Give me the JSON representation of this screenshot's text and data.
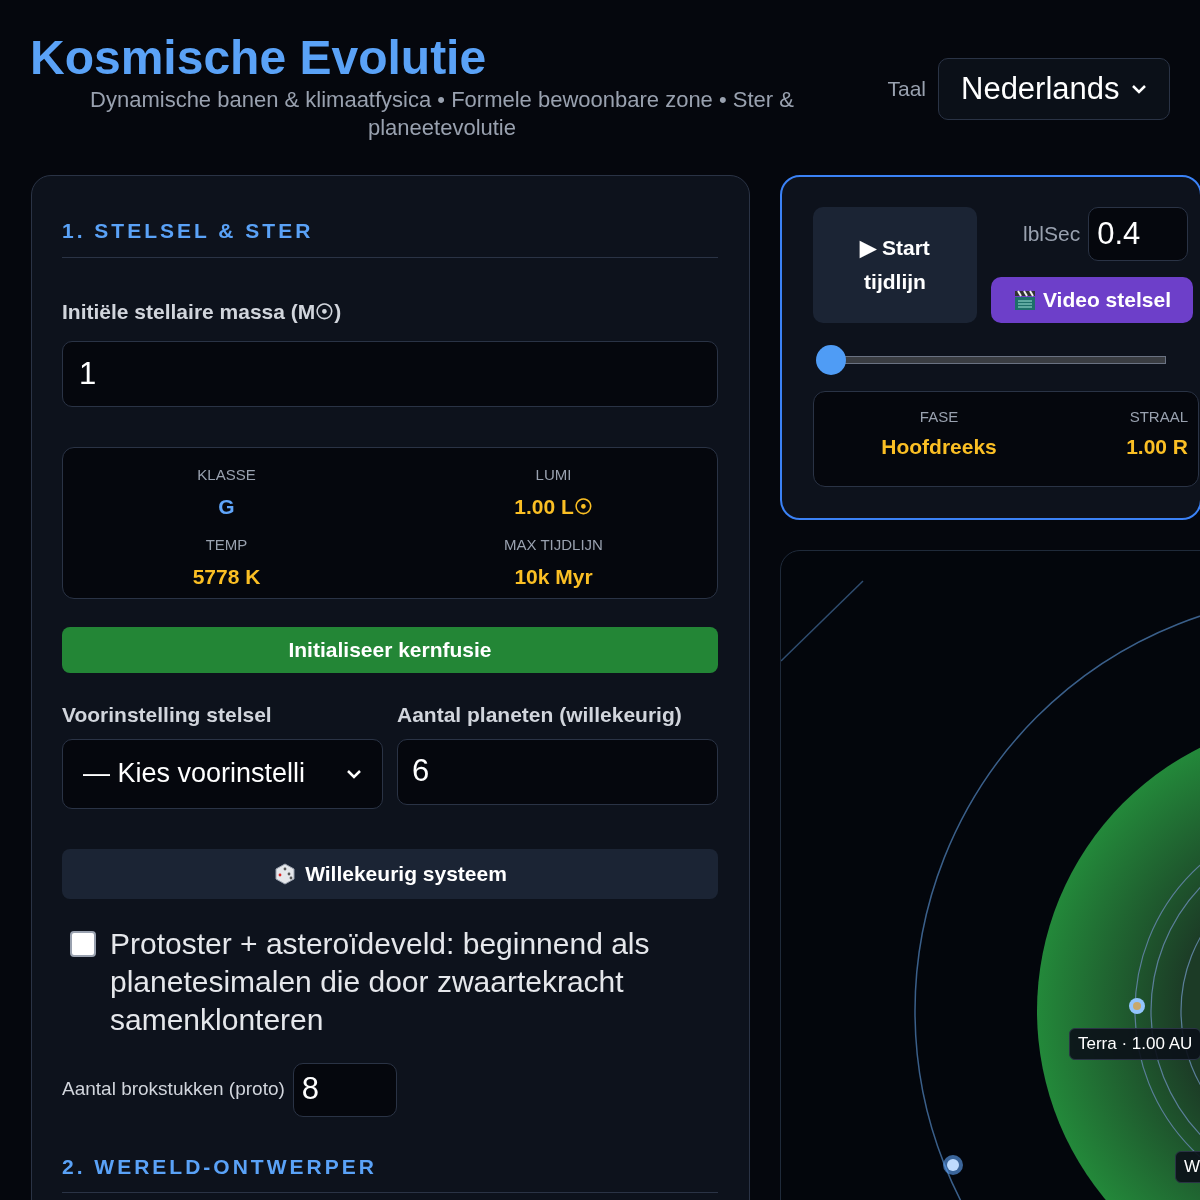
{
  "header": {
    "title": "Kosmische Evolutie",
    "subtitle": "Dynamische banen & klimaatfysica • Formele bewoonbare zone • Ster & planeetevolutie",
    "language": {
      "label": "Taal",
      "value": "Nederlands"
    }
  },
  "setup_panel": {
    "section_1_heading": "1. STELSEL & STER",
    "mass_field": {
      "label": "Initiële stellaire massa (M☉)",
      "value": "1"
    },
    "star_stats": [
      {
        "label": "KLASSE",
        "value": "G",
        "color": "#60a5fa"
      },
      {
        "label": "LUMI",
        "value": "1.00 L☉",
        "color": "#fbbf24"
      },
      {
        "label": "TEMP",
        "value": "5778 K",
        "color": "#fbbf24"
      },
      {
        "label": "MAX TIJDLIJN",
        "value": "10k Myr",
        "color": "#fbbf24"
      }
    ],
    "ignite_button": "Initialiseer kernfusie",
    "preset_field": {
      "label": "Voorinstelling stelsel",
      "value": "— Kies voorinstelli"
    },
    "planet_count_field": {
      "label": "Aantal planeten (willekeurig)",
      "value": "6"
    },
    "random_button": "Willekeurig systeem",
    "protostar_option": {
      "label": "Protoster + asteroïdeveld: beginnend als planetesimalen die door zwaartekracht samenklonteren",
      "checked": false
    },
    "debris_field": {
      "label": "Aantal brokstukken (proto)",
      "value": "8"
    },
    "section_2_heading": "2. WERELD-ONTWERPER"
  },
  "timeline_panel": {
    "play_button": {
      "icon": "▶",
      "label": "Start tijdlijn"
    },
    "speed_field": {
      "label": "lblSec",
      "value": "0.4"
    },
    "video_button": "Video stelsel",
    "timeline_slider": {
      "level": 0
    },
    "stats": [
      {
        "label": "FASE",
        "value": "Hoofdreeks"
      },
      {
        "label": "STRAAL",
        "value": "1.00 R"
      }
    ]
  },
  "orbit_view": {
    "planet_labels": [
      {
        "label": "Terra · 1.00 AU"
      },
      {
        "label": "W"
      }
    ]
  }
}
